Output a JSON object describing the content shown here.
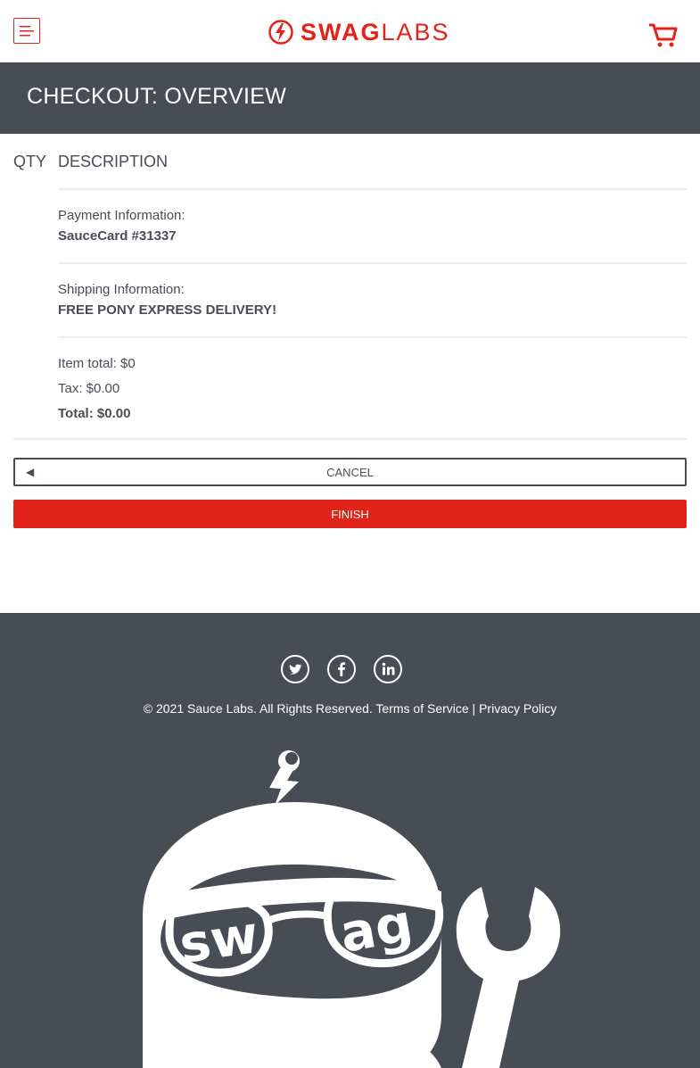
{
  "header": {
    "menu_icon": "hamburger-menu-icon",
    "logo_bold": "SWAG",
    "logo_light": "LABS",
    "logo_icon": "lightning-bolt-logo-icon",
    "cart_icon": "shopping-cart-icon"
  },
  "subheader": {
    "title": "CHECKOUT: OVERVIEW"
  },
  "cart_list": {
    "qty_label": "QTY",
    "desc_label": "DESCRIPTION"
  },
  "summary": {
    "payment_label": "Payment Information:",
    "payment_value": "SauceCard #31337",
    "shipping_label": "Shipping Information:",
    "shipping_value": "FREE PONY EXPRESS DELIVERY!",
    "subtotal": "Item total: $0",
    "tax": "Tax: $0.00",
    "total": "Total: $0.00"
  },
  "buttons": {
    "cancel": "CANCEL",
    "cancel_icon": "back-arrow-icon",
    "finish": "FINISH"
  },
  "footer": {
    "social": [
      "twitter-icon",
      "facebook-icon",
      "linkedin-icon"
    ],
    "copyright": "© 2021 Sauce Labs. All Rights Reserved. Terms of Service | Privacy Policy",
    "mascot_text": "swag"
  },
  "colors": {
    "brand_red": "#e2231a",
    "dark_gray": "#474c55",
    "divider": "#ededed"
  }
}
